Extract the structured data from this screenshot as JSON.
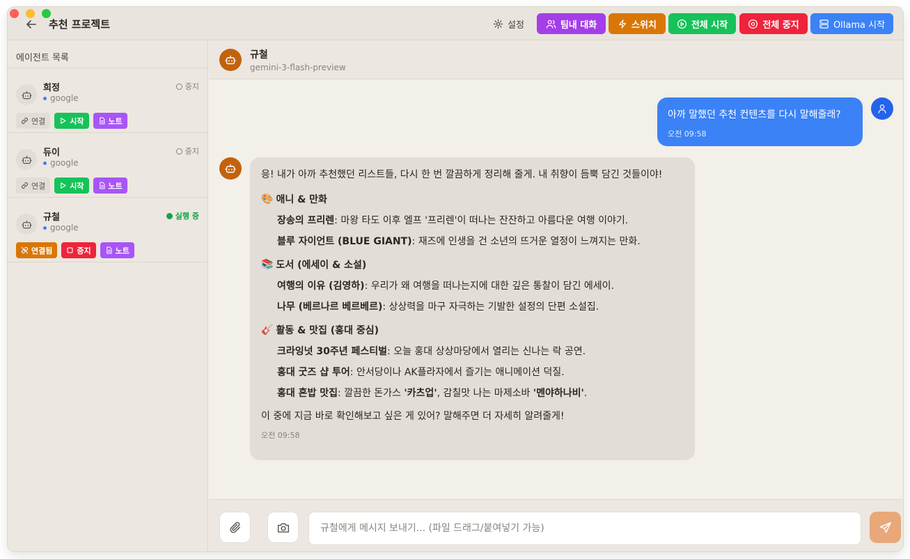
{
  "window": {
    "controls": [
      "close",
      "minimize",
      "zoom"
    ]
  },
  "topbar": {
    "back_icon": "arrow-left-icon",
    "title": "추천 프로젝트",
    "settings_label": "설정",
    "buttons": [
      {
        "label": "팀내 대화",
        "icon": "users-icon",
        "color": "#a33ee8"
      },
      {
        "label": "스위치",
        "icon": "zap-icon",
        "color": "#d97706"
      },
      {
        "label": "전체 시작",
        "icon": "play-circle-icon",
        "color": "#16c25a"
      },
      {
        "label": "전체 중지",
        "icon": "stop-circle-icon",
        "color": "#ef233c"
      },
      {
        "label": "Ollama 시작",
        "icon": "server-icon",
        "color": "#3b82f6"
      }
    ]
  },
  "sidebar": {
    "header": "에이전트 목록",
    "agents": [
      {
        "name": "희정",
        "provider": "google",
        "status": "중지",
        "running": false,
        "actions": {
          "link": "연결",
          "start": "시작",
          "note": "노트"
        }
      },
      {
        "name": "듀이",
        "provider": "google",
        "status": "중지",
        "running": false,
        "actions": {
          "link": "연결",
          "start": "시작",
          "note": "노트"
        }
      },
      {
        "name": "규철",
        "provider": "google",
        "status": "실행 중",
        "running": true,
        "actions": {
          "link": "연결됨",
          "stop": "중지",
          "note": "노트"
        }
      }
    ]
  },
  "chat": {
    "agent_name": "규철",
    "model": "gemini-3-flash-preview",
    "user_message": {
      "text": "아까 말했던 추천 컨텐츠를 다시 말해줄래?",
      "time": "오전 09:58"
    },
    "bot_message": {
      "intro": "응! 내가 아까 추천했던 리스트들, 다시 한 번 깔끔하게 정리해 줄게. 내 취향이 듬뿍 담긴 것들이야!",
      "sections": [
        {
          "emoji": "🎨",
          "title": "애니 & 만화",
          "items": [
            {
              "name": "장송의 프리렌",
              "desc": ": 마왕 타도 이후 엘프 '프리렌'이 떠나는 잔잔하고 아름다운 여행 이야기."
            },
            {
              "name": "블루 자이언트 (BLUE GIANT)",
              "desc": ": 재즈에 인생을 건 소년의 뜨거운 열정이 느껴지는 만화."
            }
          ]
        },
        {
          "emoji": "📚",
          "title": "도서 (에세이 & 소설)",
          "items": [
            {
              "name": "여행의 이유 (김영하)",
              "desc": ": 우리가 왜 여행을 떠나는지에 대한 깊은 통찰이 담긴 에세이."
            },
            {
              "name": "나무 (베르나르 베르베르)",
              "desc": ": 상상력을 마구 자극하는 기발한 설정의 단편 소설집."
            }
          ]
        },
        {
          "emoji": "🎸",
          "title": "활동 & 맛집 (홍대 중심)",
          "items": [
            {
              "name": "크라잉넛 30주년 페스티벌",
              "desc": ": 오늘 홍대 상상마당에서 열리는 신나는 락 공연."
            },
            {
              "name": "홍대 굿즈 샵 투어",
              "desc": ": 안서당이나 AK플라자에서 즐기는 애니메이션 덕질."
            },
            {
              "name": "홍대 혼밥 맛집",
              "desc_pre": ": 깔끔한 돈가스 ",
              "bold1": "'카츠업'",
              "desc_mid": ", 감칠맛 나는 마제소바 ",
              "bold2": "'멘야하나비'",
              "desc_post": "."
            }
          ]
        }
      ],
      "closing": "이 중에 지금 바로 확인해보고 싶은 게 있어? 말해주면 더 자세히 알려줄게!",
      "time": "오전 09:58"
    }
  },
  "composer": {
    "placeholder": "규철에게 메시지 보내기... (파일 드래그/붙여넣기 가능)",
    "attach_icon": "paperclip-icon",
    "camera_icon": "camera-icon",
    "send_icon": "send-icon"
  }
}
